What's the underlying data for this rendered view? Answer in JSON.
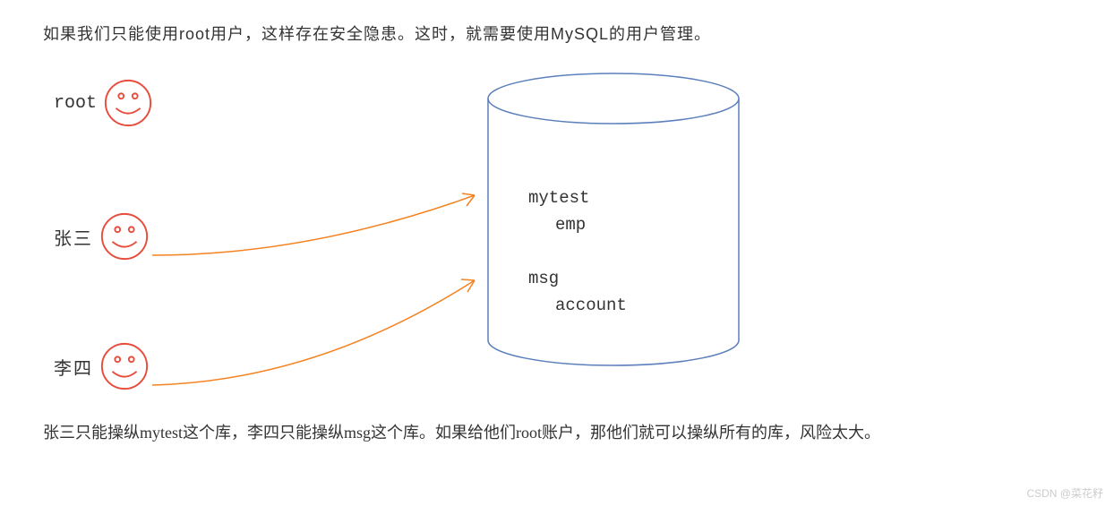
{
  "intro": "如果我们只能使用root用户，这样存在安全隐患。这时，就需要使用MySQL的用户管理。",
  "users": {
    "root": {
      "label": "root"
    },
    "zhangsan": {
      "label": "张三"
    },
    "lisi": {
      "label": "李四"
    }
  },
  "database": {
    "db1": {
      "name": "mytest",
      "table": "emp"
    },
    "db2": {
      "name": "msg",
      "table": "account"
    }
  },
  "conclusion": "张三只能操纵mytest这个库，李四只能操纵msg这个库。如果给他们root账户，那他们就可以操纵所有的库，风险太大。",
  "watermark": "CSDN @菜花籽",
  "colors": {
    "smiley": "#e74c3c",
    "arrow": "#f58220",
    "cylinder": "#5b7fbb"
  }
}
